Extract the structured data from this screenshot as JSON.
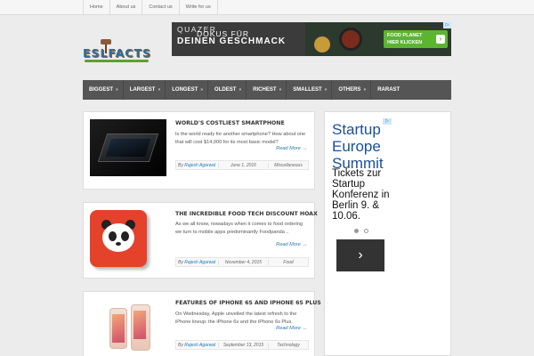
{
  "top_links": [
    "Home",
    "About us",
    "Contact us",
    "Write for us"
  ],
  "logo": {
    "text": "ESLFACTS"
  },
  "ad_banner": {
    "brand": "QUAZER",
    "headline": "DEINEN GESCHMACK",
    "headline_prefix": "DOKUS FÜR",
    "cta_line1": "FOOD PLANET",
    "cta_line2": "HIER KLICKEN",
    "cta_arrow": "›",
    "ad_marker": "▷",
    "colors": {
      "cta": "#5cb531"
    }
  },
  "nav": {
    "items": [
      {
        "label": "BIGGEST",
        "arrow": "»"
      },
      {
        "label": "LARGEST",
        "arrow": "»"
      },
      {
        "label": "LONGEST",
        "arrow": "»"
      },
      {
        "label": "OLDEST",
        "arrow": "»"
      },
      {
        "label": "RICHEST",
        "arrow": "»"
      },
      {
        "label": "SMALLEST",
        "arrow": "»"
      },
      {
        "label": "OTHERS",
        "arrow": "»"
      },
      {
        "label": "RARAST",
        "arrow": ""
      }
    ]
  },
  "posts": [
    {
      "title": "WORLD'S COSTLIEST SMARTPHONE",
      "excerpt": "Is the world ready for another smartphone? How about one that will cost $14,000 for its most basic model?",
      "read_more": "Read More →",
      "by": "By",
      "author": "Rajesh Agarwal",
      "date": "June 1, 2016",
      "category": "Miscellaneous"
    },
    {
      "title": "THE INCREDIBLE FOOD TECH DISCOUNT HOAX",
      "excerpt": "As we all know, nowadays when it comes to food ordering we turn to mobile apps predominantly Foodpanda ..",
      "read_more": "Read More →",
      "by": "By",
      "author": "Rajesh Agarwal",
      "date": "November 4, 2015",
      "category": "Food"
    },
    {
      "title": "FEATURES OF IPHONE 6S AND IPHONE 6S PLUS",
      "excerpt": "On Wednesday, Apple unveiled the latest refresh to the iPhone lineup: the iPhone 6s and the iPhone 6s Plus.",
      "read_more": "Read More →",
      "by": "By",
      "author": "Rajesh Agarwal",
      "date": "September 13, 2015",
      "category": "Technology"
    }
  ],
  "side_ad": {
    "title": "Startup Europe Summit",
    "body": "Tickets zur Startup Konferenz in Berlin 9. & 10.06.",
    "next_arrow": "›",
    "ad_marker": "▷",
    "colors": {
      "title": "#1a4f9a"
    }
  }
}
